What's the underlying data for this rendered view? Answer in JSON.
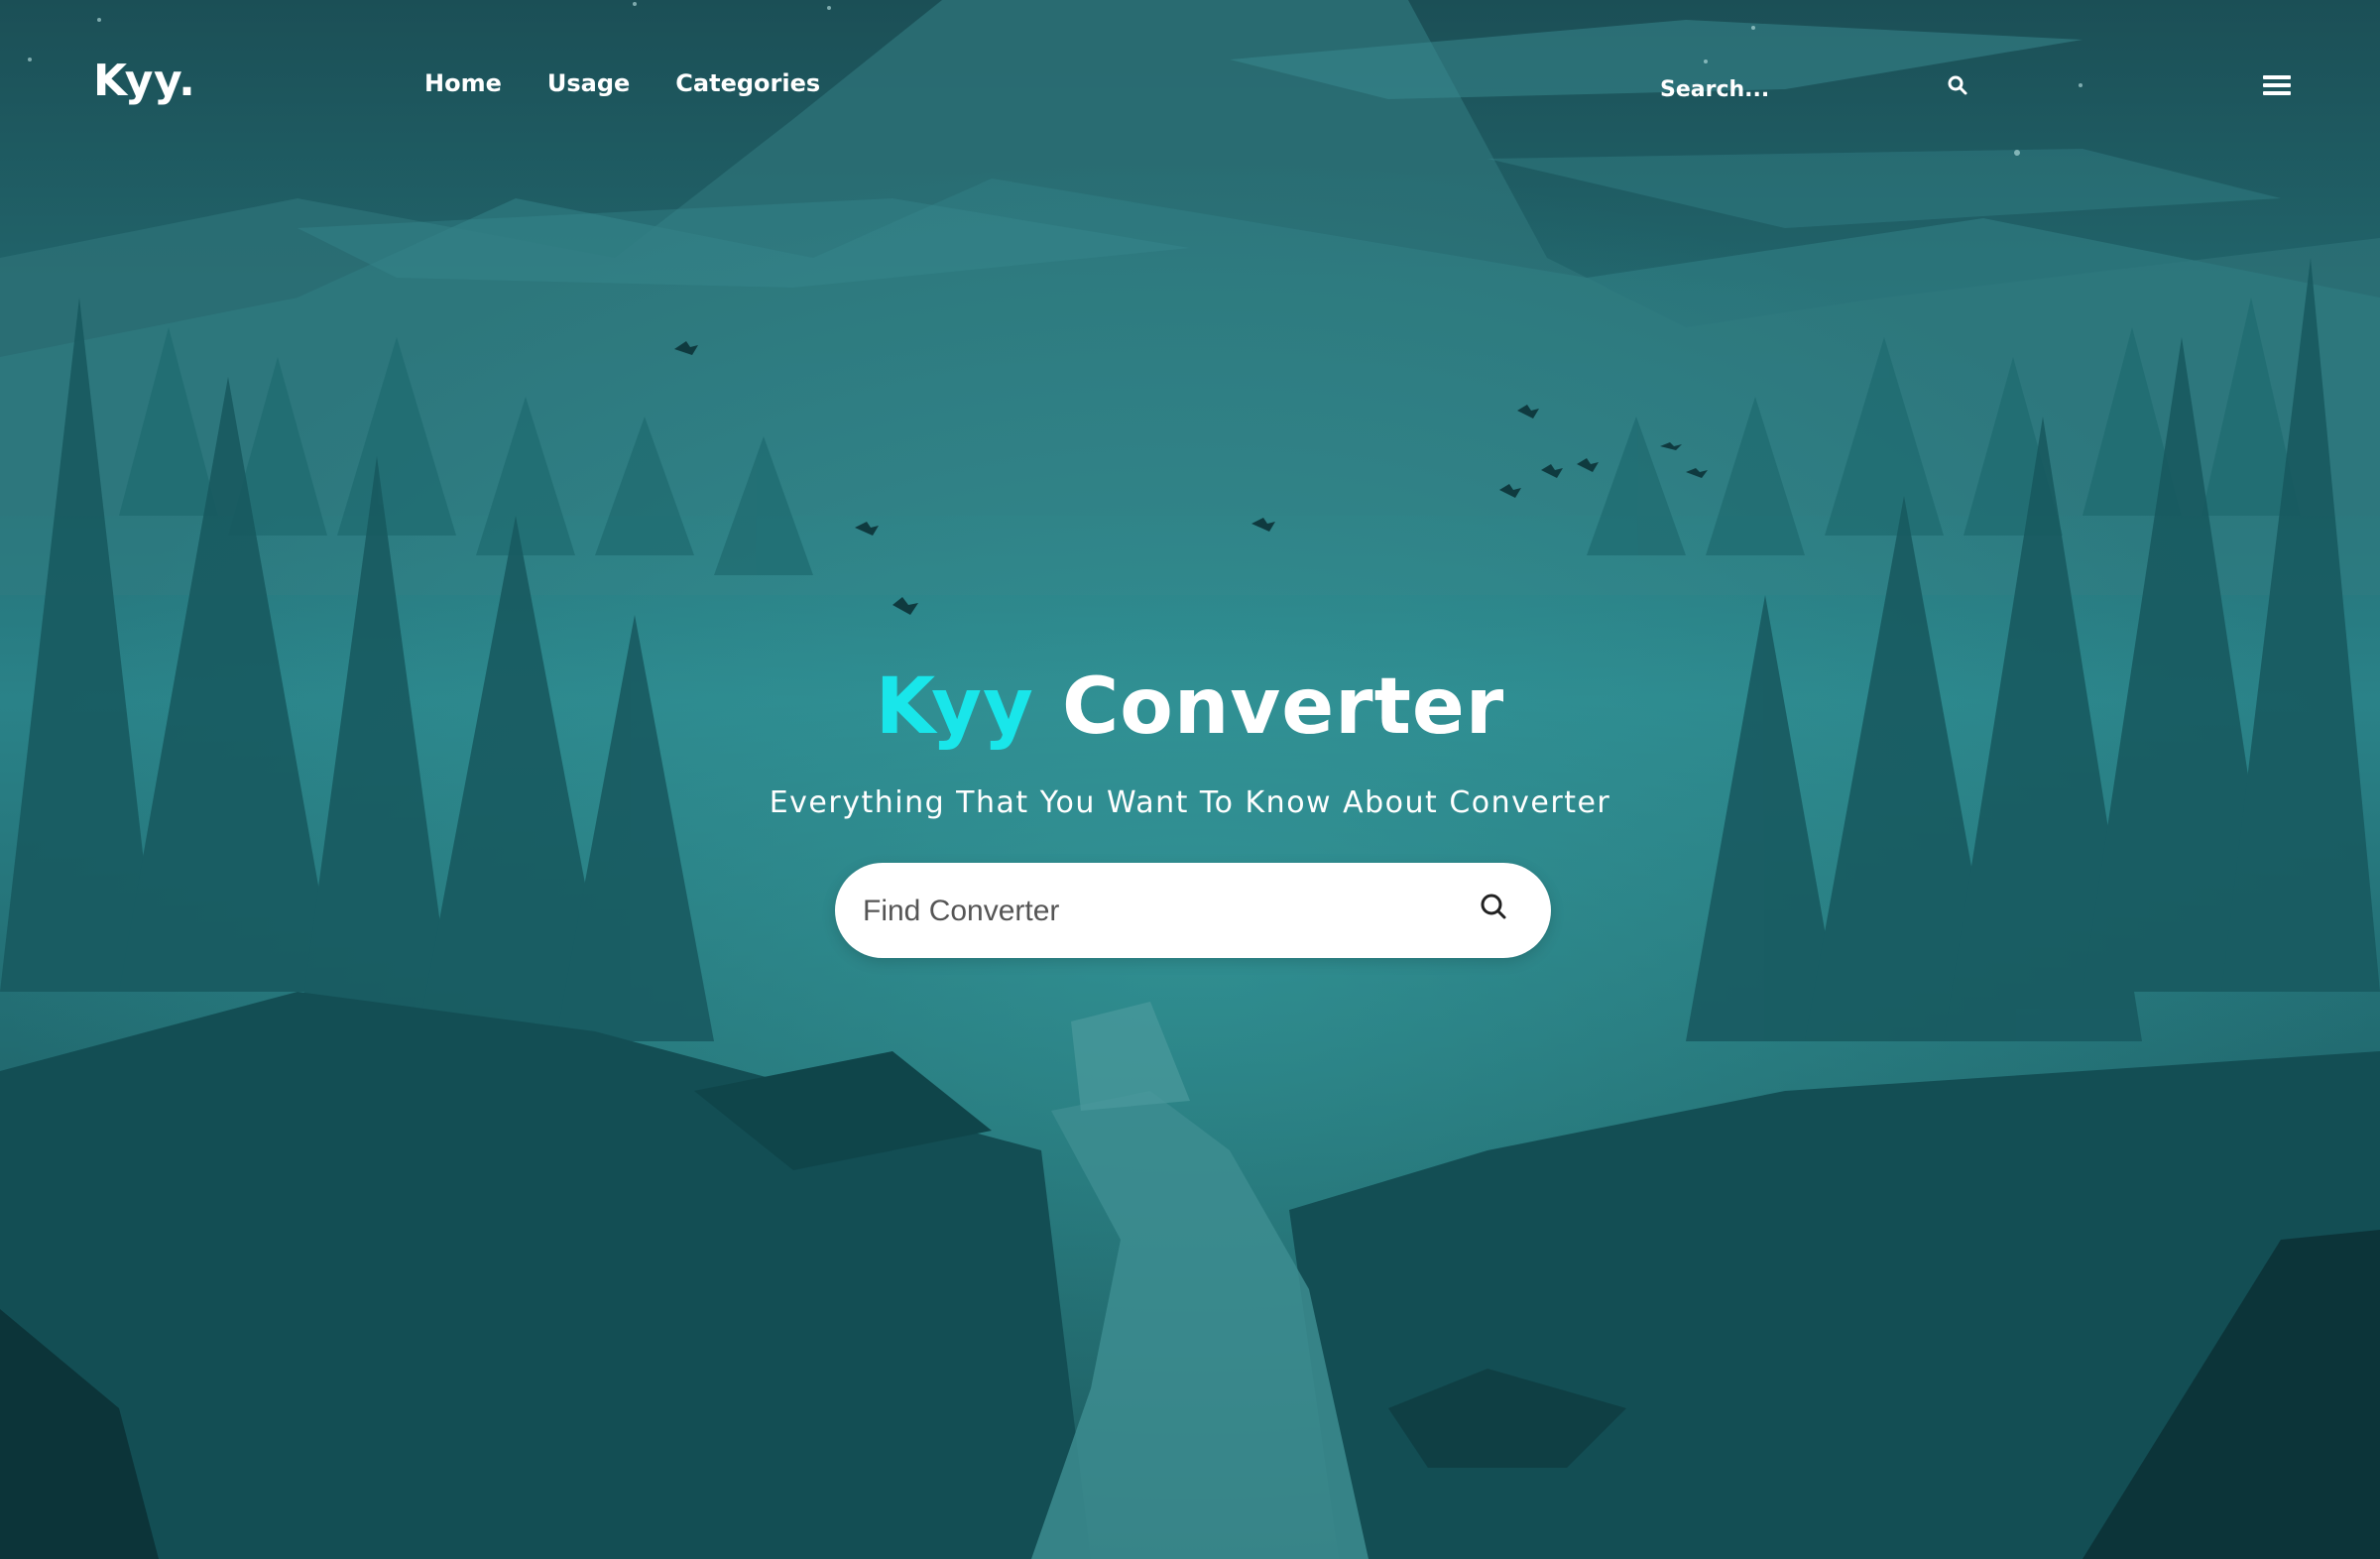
{
  "header": {
    "logo": "Kyy.",
    "nav": [
      {
        "label": "Home"
      },
      {
        "label": "Usage"
      },
      {
        "label": "Categories"
      }
    ],
    "search_placeholder": "Search...",
    "search_icon": "search-icon",
    "menu_icon": "hamburger-menu-icon"
  },
  "hero": {
    "title_accent": "Kyy",
    "title_main": "Converter",
    "subtitle": "Everything That You Want To Know About Converter",
    "search_placeholder": "Find Converter",
    "search_icon": "search-icon"
  },
  "colors": {
    "accent": "#19e6ea",
    "background": "#1f5f63",
    "text": "#ffffff"
  }
}
